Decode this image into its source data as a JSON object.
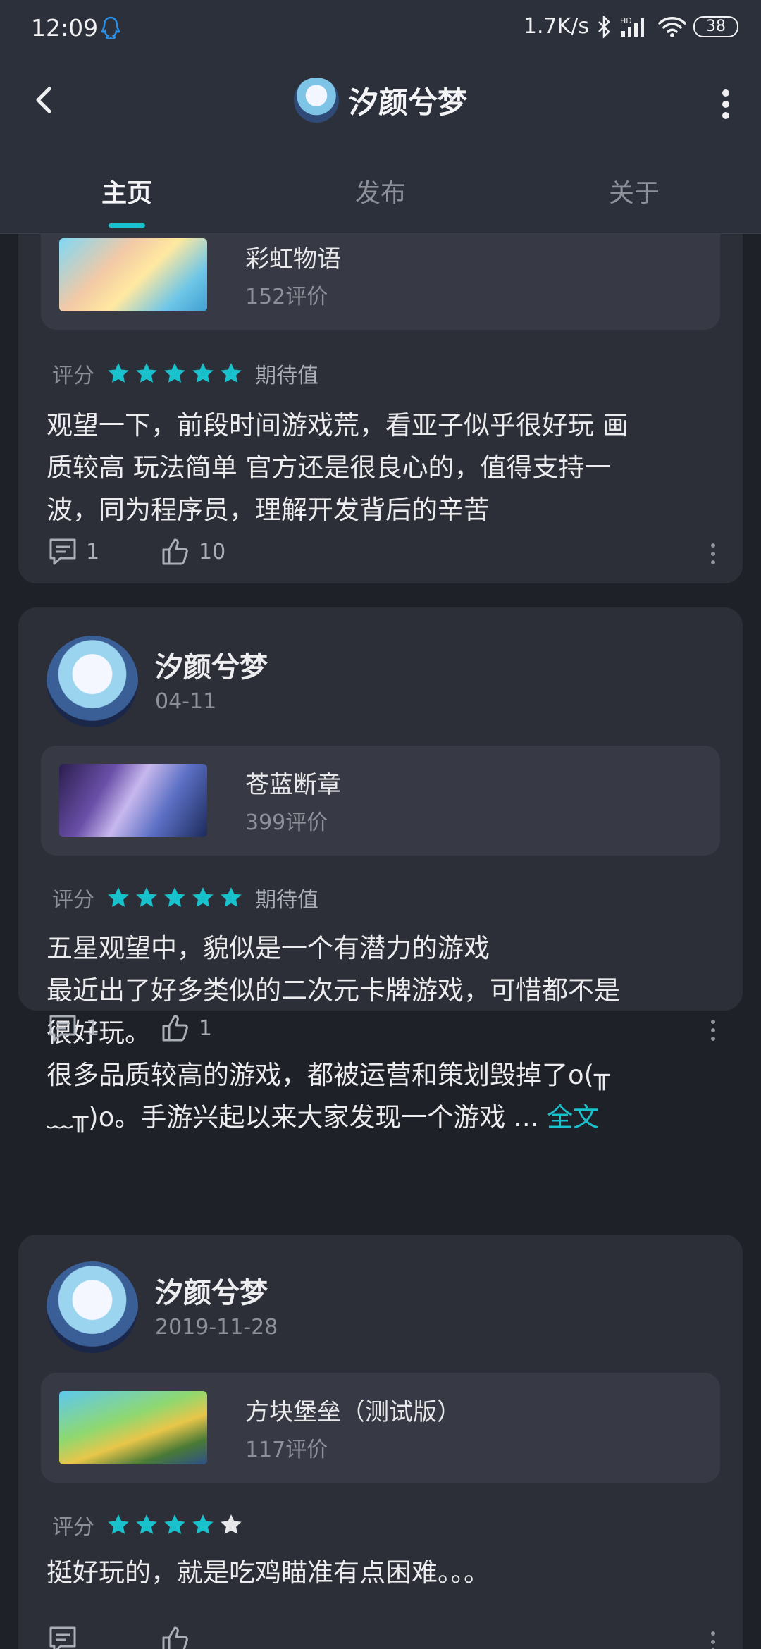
{
  "status_bar": {
    "time": "12:09",
    "network_speed": "1.7K/s",
    "signal_label": "HD",
    "battery": "38"
  },
  "header": {
    "title": "汐颜兮梦"
  },
  "tabs": [
    {
      "label": "主页",
      "active": true
    },
    {
      "label": "发布",
      "active": false
    },
    {
      "label": "关于",
      "active": false
    }
  ],
  "colors": {
    "accent": "#19c1cc",
    "background": "#1f2128",
    "card": "#2c2f37",
    "star_empty": "#e8e8ea"
  },
  "reviews": [
    {
      "game": {
        "name": "彩虹物语",
        "reviews": "152评价"
      },
      "rating_label": "评分",
      "stars": 5,
      "rating_text": "期待值",
      "text_lines": [
        "观望一下，前段时间游戏荒，看亚子似乎很好玩 画",
        "质较高 玩法简单 官方还是很良心的，值得支持一",
        "波，同为程序员，理解开发背后的辛苦"
      ],
      "comments": "1",
      "likes": "10"
    },
    {
      "user": "汐颜兮梦",
      "date": "04-11",
      "game": {
        "name": "苍蓝断章",
        "reviews": "399评价"
      },
      "rating_label": "评分",
      "stars": 5,
      "rating_text": "期待值",
      "text_lines": [
        "五星观望中，貌似是一个有潜力的游戏",
        "最近出了好多类似的二次元卡牌游戏，可惜都不是",
        "很好玩。",
        "很多品质较高的游戏，都被运营和策划毁掉了o(╥",
        "﹏╥)o。手游兴起以来大家发现一个游戏 ..."
      ],
      "full_label": "全文",
      "comments": "1",
      "likes": "1"
    },
    {
      "user": "汐颜兮梦",
      "date": "2019-11-28",
      "game": {
        "name": "方块堡垒（测试版）",
        "reviews": "117评价"
      },
      "rating_label": "评分",
      "stars": 4,
      "text_lines": [
        "挺好玩的，就是吃鸡瞄准有点困难。。。"
      ]
    }
  ]
}
